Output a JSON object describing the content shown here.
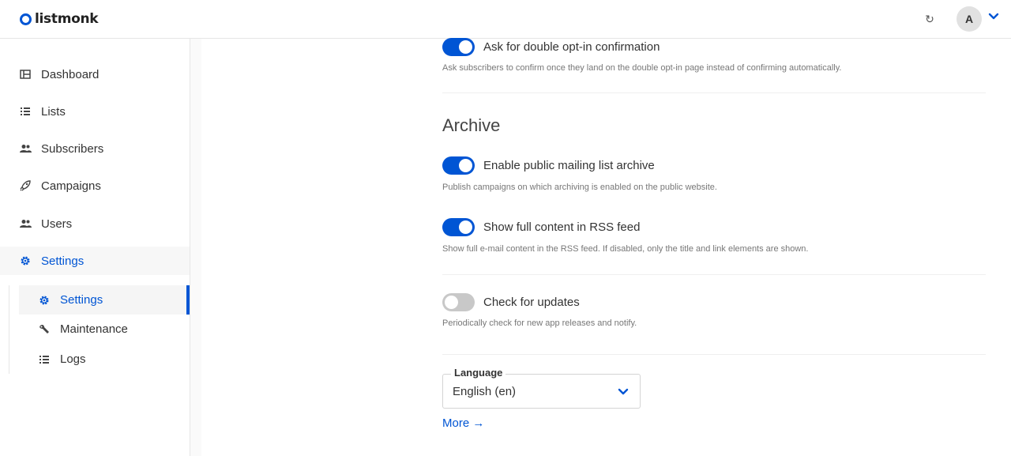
{
  "app": {
    "logo_text": "listmonk"
  },
  "header": {
    "refresh_glyph": "↻",
    "avatar_initial": "A",
    "accent": "#0055d4"
  },
  "sidebar": {
    "items": [
      {
        "label": "Dashboard",
        "icon": "dashboard-icon"
      },
      {
        "label": "Lists",
        "icon": "list-icon"
      },
      {
        "label": "Subscribers",
        "icon": "users-icon"
      },
      {
        "label": "Campaigns",
        "icon": "rocket-icon"
      },
      {
        "label": "Users",
        "icon": "users-icon"
      },
      {
        "label": "Settings",
        "icon": "gear-icon",
        "active": true
      }
    ],
    "subitems": [
      {
        "label": "Settings",
        "icon": "gear-icon",
        "active": true
      },
      {
        "label": "Maintenance",
        "icon": "wrench-icon"
      },
      {
        "label": "Logs",
        "icon": "list-icon"
      }
    ]
  },
  "settings": {
    "double_optin": {
      "label": "Ask for double opt-in confirmation",
      "help": "Ask subscribers to confirm once they land on the double opt-in page instead of confirming automatically.",
      "enabled": true
    },
    "archive_title": "Archive",
    "public_archive": {
      "label": "Enable public mailing list archive",
      "help": "Publish campaigns on which archiving is enabled on the public website.",
      "enabled": true
    },
    "rss_full": {
      "label": "Show full content in RSS feed",
      "help": "Show full e-mail content in the RSS feed. If disabled, only the title and link elements are shown.",
      "enabled": true
    },
    "check_updates": {
      "label": "Check for updates",
      "help": "Periodically check for new app releases and notify.",
      "enabled": false
    },
    "language": {
      "label": "Language",
      "value": "English (en)"
    },
    "more_link": "More →"
  }
}
